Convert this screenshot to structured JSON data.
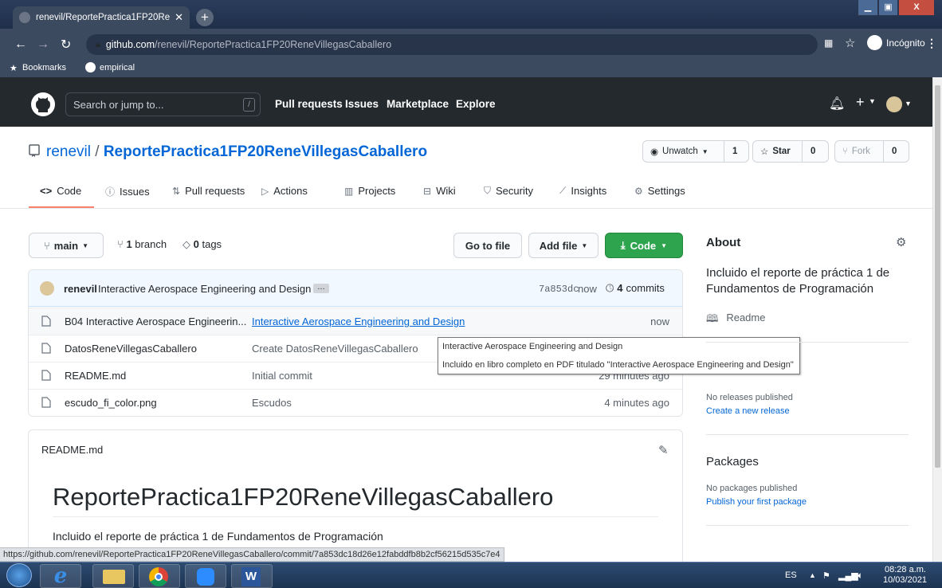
{
  "browser": {
    "tab_title": "renevil/ReportePractica1FP20Rene",
    "url_domain": "github.com",
    "url_path": "/renevil/ReportePractica1FP20ReneVillegasCaballero",
    "incognito_label": "Incógnito",
    "bookmarks": [
      "Bookmarks",
      "empirical"
    ],
    "status_url": "https://github.com/renevil/ReportePractica1FP20ReneVillegasCaballero/commit/7a853dc18d26e12fabddfb8b2cf56215d535c7e4"
  },
  "header": {
    "search_placeholder": "Search or jump to...",
    "search_key": "/",
    "nav": [
      "Pull requests",
      "Issues",
      "Marketplace",
      "Explore"
    ]
  },
  "repo": {
    "owner": "renevil",
    "separator": "/",
    "name": "ReportePractica1FP20ReneVillegasCaballero",
    "unwatch_label": "Unwatch",
    "watch_count": "1",
    "star_label": "Star",
    "star_count": "0",
    "fork_label": "Fork",
    "fork_count": "0",
    "tabs": [
      "Code",
      "Issues",
      "Pull requests",
      "Actions",
      "Projects",
      "Wiki",
      "Security",
      "Insights",
      "Settings"
    ]
  },
  "filenav": {
    "branch": "main",
    "branches_count": "1",
    "branches_label": "branch",
    "tags_count": "0",
    "tags_label": "tags",
    "go_to_file": "Go to file",
    "add_file": "Add file",
    "code": "Code"
  },
  "commit": {
    "author": "renevil",
    "message": "Interactive Aerospace Engineering and Design",
    "ellipsis": "…",
    "sha": "7a853dc",
    "time": "now",
    "commits_count": "4",
    "commits_label": "commits"
  },
  "files": [
    {
      "name": "B04 Interactive Aerospace Engineerin...",
      "message": "Interactive Aerospace Engineering and Design",
      "time": "now"
    },
    {
      "name": "DatosReneVillegasCaballero",
      "message": "Create DatosReneVillegasCaballero",
      "time": ""
    },
    {
      "name": "README.md",
      "message": "Initial commit",
      "time": "29 minutes ago"
    },
    {
      "name": "escudo_fi_color.png",
      "message": "Escudos",
      "time": "4 minutes ago"
    }
  ],
  "tooltip": {
    "line1": "Interactive Aerospace Engineering and Design",
    "line2": "Incluido en libro completo en PDF titulado \"Interactive Aerospace Engineering and Design\""
  },
  "readme": {
    "file": "README.md",
    "title": "ReportePractica1FP20ReneVillegasCaballero",
    "text": "Incluido el reporte de práctica 1 de Fundamentos de Programación"
  },
  "about": {
    "heading": "About",
    "description": "Incluido el reporte de práctica 1 de Fundamentos de Programación",
    "readme_link": "Readme",
    "no_releases": "No releases published",
    "create_release": "Create a new release",
    "packages_heading": "Packages",
    "no_packages": "No packages published",
    "publish_package": "Publish your first package"
  },
  "taskbar": {
    "lang": "ES",
    "time": "08:28 a.m.",
    "date": "10/03/2021"
  },
  "colors": {
    "link": "#0366d6",
    "green_button": "#2ea44f",
    "header_bg": "#24292e",
    "tab_underline": "#f9826c"
  }
}
